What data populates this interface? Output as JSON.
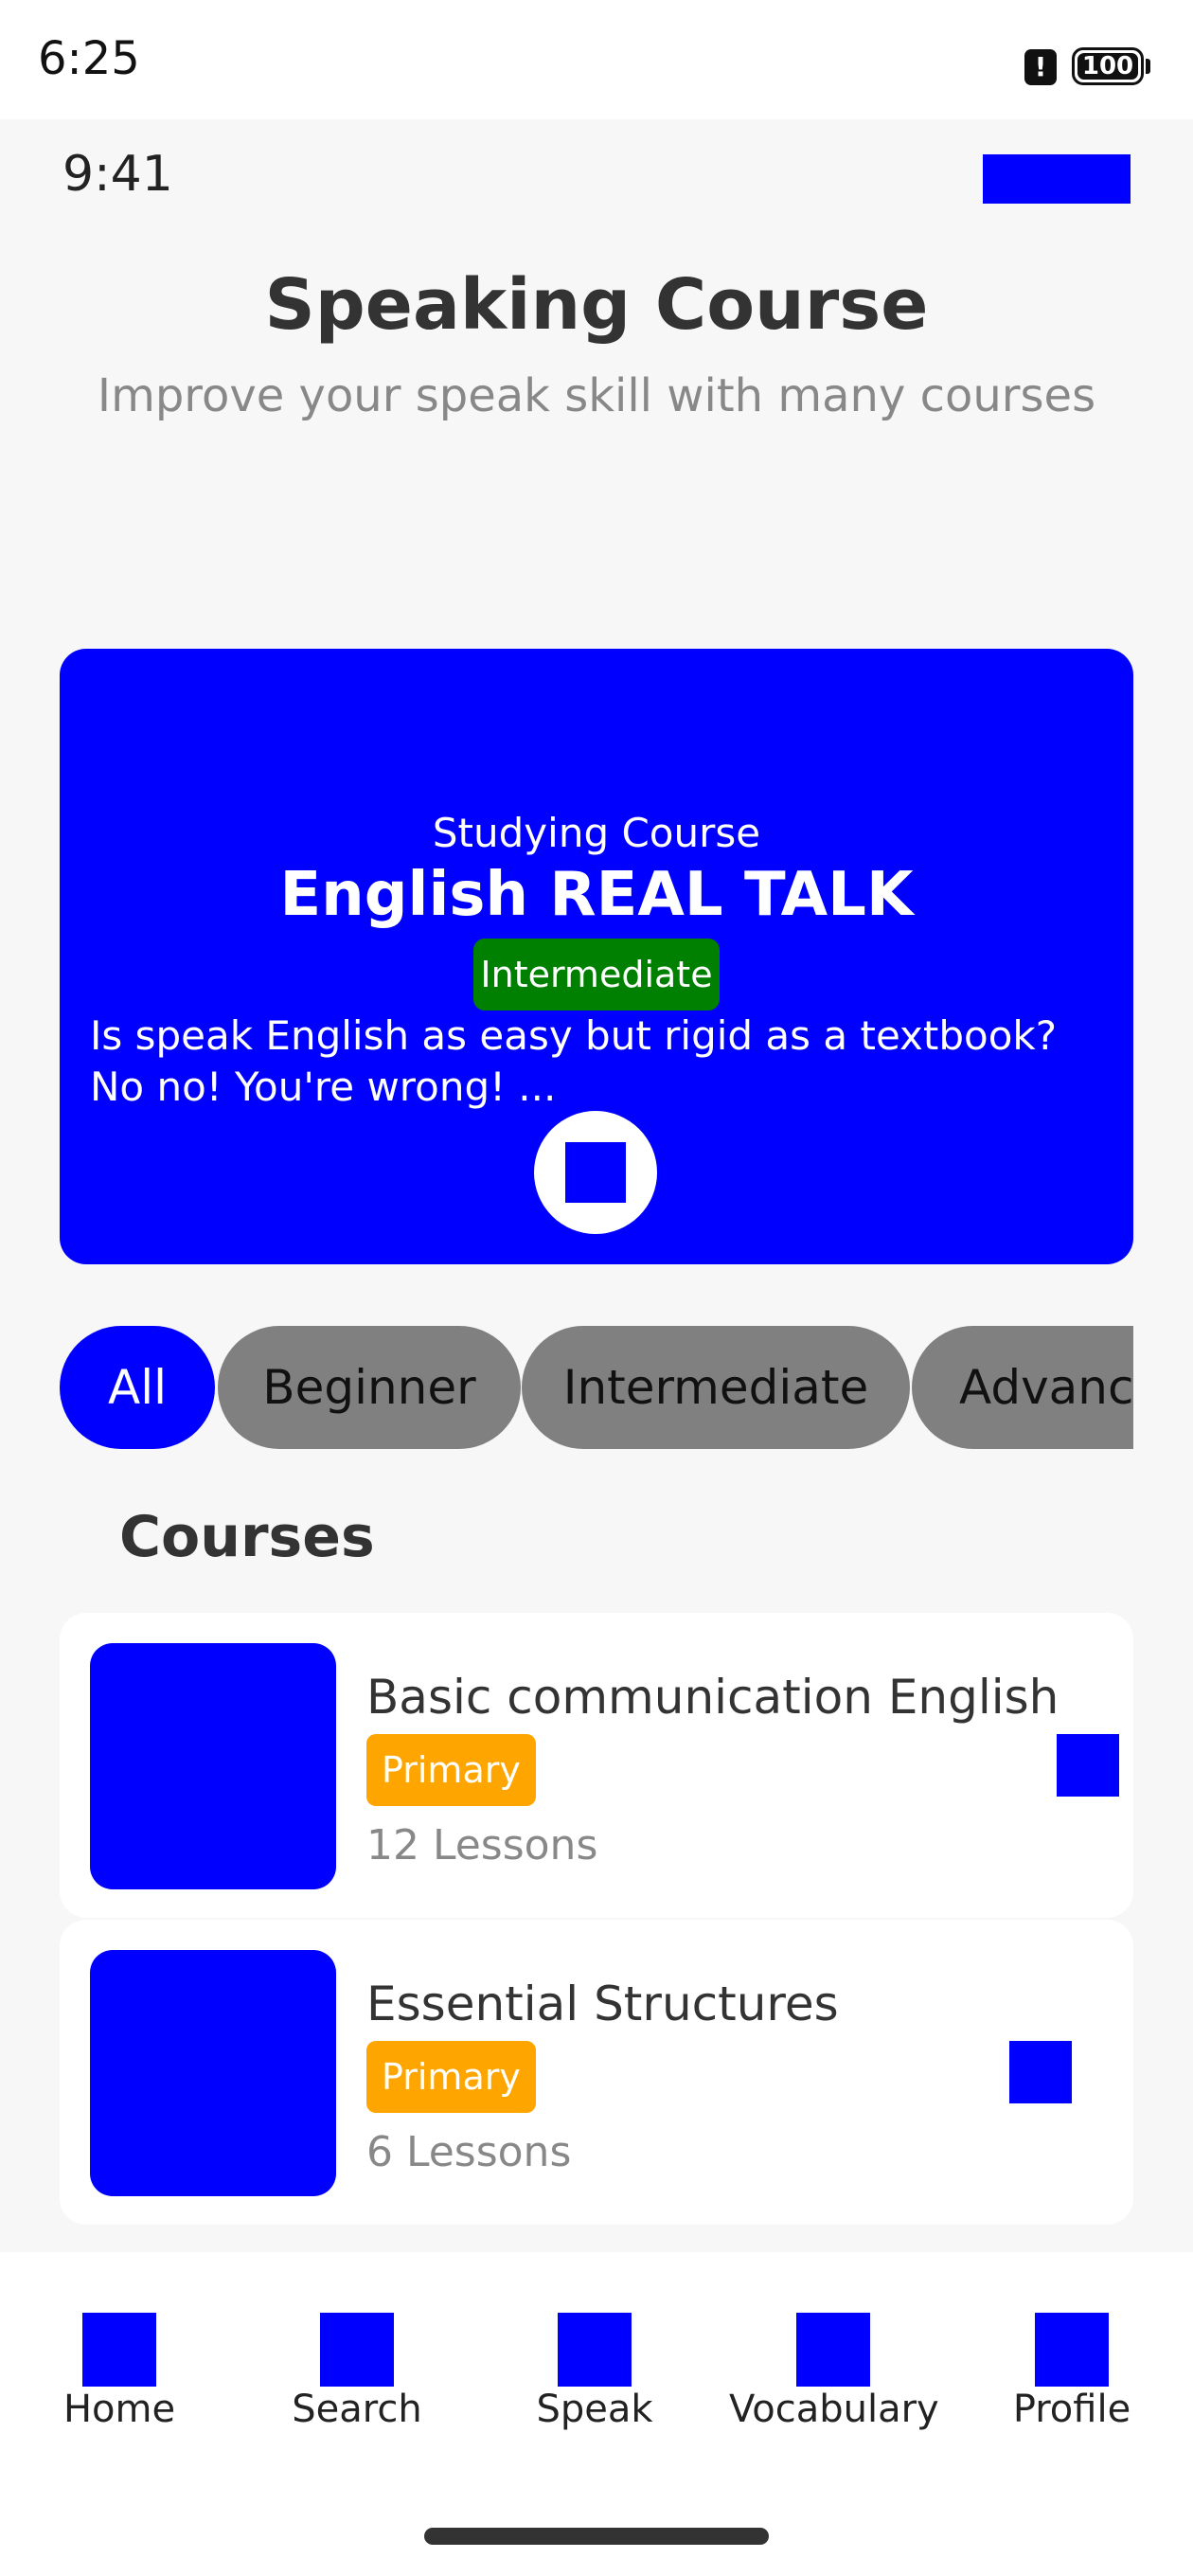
{
  "status_bar": {
    "time": "6:25",
    "alert_icon": "!",
    "battery": "100"
  },
  "header": {
    "time": "9:41",
    "title": "Speaking Course",
    "subtitle": "Improve your speak skill with many courses"
  },
  "hero": {
    "kicker": "Studying Course",
    "title": "English REAL TALK",
    "level": "Intermediate",
    "description": "Is speak English as easy but rigid as a textbook? No no! You're wrong! ...",
    "action_icon": "play-icon"
  },
  "filters": [
    {
      "label": "All",
      "active": true
    },
    {
      "label": "Beginner",
      "active": false
    },
    {
      "label": "Intermediate",
      "active": false
    },
    {
      "label": "Advanced",
      "active": false
    }
  ],
  "courses_section": {
    "title": "Courses"
  },
  "courses": [
    {
      "title": "Basic communication English",
      "tag": "Primary",
      "lessons": "12 Lessons"
    },
    {
      "title": "Essential Structures",
      "tag": "Primary",
      "lessons": "6 Lessons"
    }
  ],
  "bottom_nav": [
    {
      "label": "Home",
      "icon": "home-icon"
    },
    {
      "label": "Search",
      "icon": "search-icon"
    },
    {
      "label": "Speak",
      "icon": "microphone-icon"
    },
    {
      "label": "Vocabulary",
      "icon": "book-icon"
    },
    {
      "label": "Profile",
      "icon": "user-icon"
    }
  ],
  "colors": {
    "accent": "#0000ff",
    "level_badge": "#008000",
    "tag": "#ffa500",
    "chip_idle": "#808080"
  }
}
